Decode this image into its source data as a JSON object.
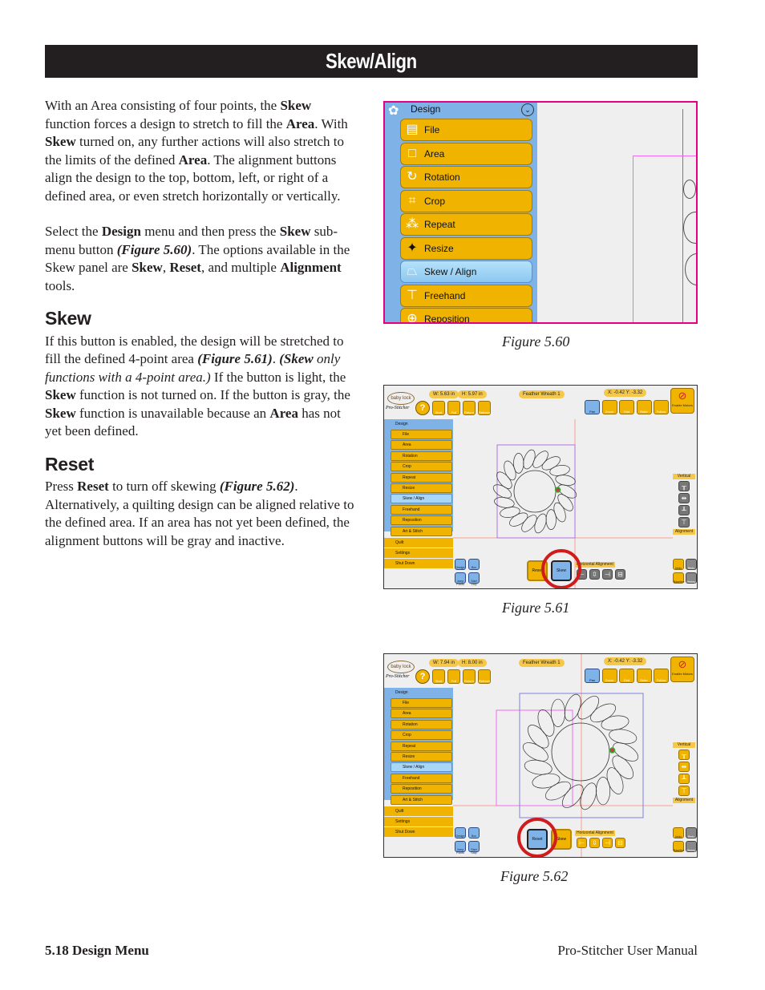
{
  "page": {
    "title": "Skew/Align",
    "intro": {
      "p1": [
        {
          "t": "With an Area consisting of four points, the "
        },
        {
          "t": "Skew",
          "b": true
        },
        {
          "t": " function forces a design to stretch to fill the "
        },
        {
          "t": "Area",
          "b": true
        },
        {
          "t": ". With "
        },
        {
          "t": "Skew",
          "b": true
        },
        {
          "t": " turned on, any further actions will also stretch to the limits of the defined "
        },
        {
          "t": "Area",
          "b": true
        },
        {
          "t": ". The alignment buttons align the design to the top, bottom, left, or right of a defined area, or even stretch horizontally or vertically."
        }
      ],
      "p2": [
        {
          "t": "Select the "
        },
        {
          "t": "Design",
          "b": true
        },
        {
          "t": " menu and then press the "
        },
        {
          "t": "Skew",
          "b": true
        },
        {
          "t": " sub-menu button "
        },
        {
          "t": "(Figure 5.60)",
          "bi": true
        },
        {
          "t": ". The options available in the Skew panel are "
        },
        {
          "t": "Skew",
          "b": true
        },
        {
          "t": ", "
        },
        {
          "t": "Reset",
          "b": true
        },
        {
          "t": ", and multiple "
        },
        {
          "t": "Alignment",
          "b": true
        },
        {
          "t": " tools."
        }
      ]
    },
    "sections": [
      {
        "heading": "Skew",
        "body": [
          {
            "t": "If this button is enabled, the design will be stretched to fill the defined 4-point area "
          },
          {
            "t": "(Figure 5.61)",
            "bi": true
          },
          {
            "t": ". "
          },
          {
            "t": "(Skew",
            "bi": true
          },
          {
            "t": " only functions with a 4-point area.)",
            "i": true
          },
          {
            "t": " If the button is light, the "
          },
          {
            "t": "Skew",
            "b": true
          },
          {
            "t": " function is not turned on. If the button is gray, the "
          },
          {
            "t": "Skew",
            "b": true
          },
          {
            "t": " function is unavailable because an "
          },
          {
            "t": "Area",
            "b": true
          },
          {
            "t": " has not yet been defined."
          }
        ]
      },
      {
        "heading": "Reset",
        "body": [
          {
            "t": "Press "
          },
          {
            "t": "Reset",
            "b": true
          },
          {
            "t": " to turn off skewing "
          },
          {
            "t": "(Figure 5.62)",
            "bi": true
          },
          {
            "t": ". Alternatively, a quilting design can be aligned relative to the defined area. If an area has not yet been defined, the alignment buttons will be gray and inactive."
          }
        ]
      }
    ],
    "footer": {
      "left": "5.18 Design Menu",
      "right": "Pro-Stitcher User Manual"
    }
  },
  "figures": {
    "fig60": {
      "caption": "Figure 5.60",
      "menu_header": "Design",
      "items": [
        {
          "label": "File",
          "icon": "file-icon",
          "glyph": "▤"
        },
        {
          "label": "Area",
          "icon": "area-icon",
          "glyph": "□"
        },
        {
          "label": "Rotation",
          "icon": "rotation-icon",
          "glyph": "↻"
        },
        {
          "label": "Crop",
          "icon": "crop-icon",
          "glyph": "⌗"
        },
        {
          "label": "Repeat",
          "icon": "repeat-icon",
          "glyph": "⁂"
        },
        {
          "label": "Resize",
          "icon": "resize-icon",
          "glyph": "✦"
        },
        {
          "label": "Skew / Align",
          "icon": "skew-icon",
          "glyph": "⏢",
          "active": true
        },
        {
          "label": "Freehand",
          "icon": "freehand-icon",
          "glyph": "⊤"
        },
        {
          "label": "Reposition",
          "icon": "reposition-icon",
          "glyph": "⊕"
        }
      ]
    },
    "fig61": {
      "caption": "Figure 5.61",
      "logo": "baby lock",
      "logo_sub": "Pro-Stitcher",
      "width": "W: 5.63 in",
      "height": "H: 5.97 in",
      "design_name": "Feather Wreath 1",
      "coords": "X: -0.42  Y: -3.32",
      "active_bottom": "skew",
      "ring_target": "skew",
      "align_buttons_color": "gray"
    },
    "fig62": {
      "caption": "Figure 5.62",
      "logo": "baby lock",
      "logo_sub": "Pro-Stitcher",
      "width": "W: 7.94 in",
      "height": "H: 8.00 in",
      "design_name": "Feather Wreath 1",
      "coords": "X: -0.42  Y: -3.32",
      "active_bottom": "reset",
      "ring_target": "reset",
      "align_buttons_color": "gold"
    },
    "common": {
      "help": "?",
      "help_label": "Help",
      "toolbar": [
        "Start Stitch",
        "Full Stitch",
        "Return Home",
        "Refresh"
      ],
      "view_tools": [
        "Pan",
        "Zoom",
        "Grid",
        "Ruler",
        "Follow"
      ],
      "motors": "Enable Motors",
      "menu": [
        "File",
        "Area",
        "Rotation",
        "Crop",
        "Repeat",
        "Resize",
        "Skew / Align",
        "Freehand",
        "Reposition",
        "Art & Stitch"
      ],
      "menu_active": "Skew / Align",
      "menu_header": "Design",
      "groups": [
        "Quilt",
        "Settings",
        "Shut Down"
      ],
      "vertical_label": "Vertical",
      "alignment_label": "Alignment",
      "horizontal_label": "Horizontal Alignment",
      "reset": "Reset",
      "skew": "Skew",
      "small_btns": [
        "Design",
        "Box",
        "Jump Points",
        "Start Stop"
      ],
      "right_btns": [
        "Undo",
        "Redo",
        "Baseline",
        "History"
      ]
    }
  }
}
